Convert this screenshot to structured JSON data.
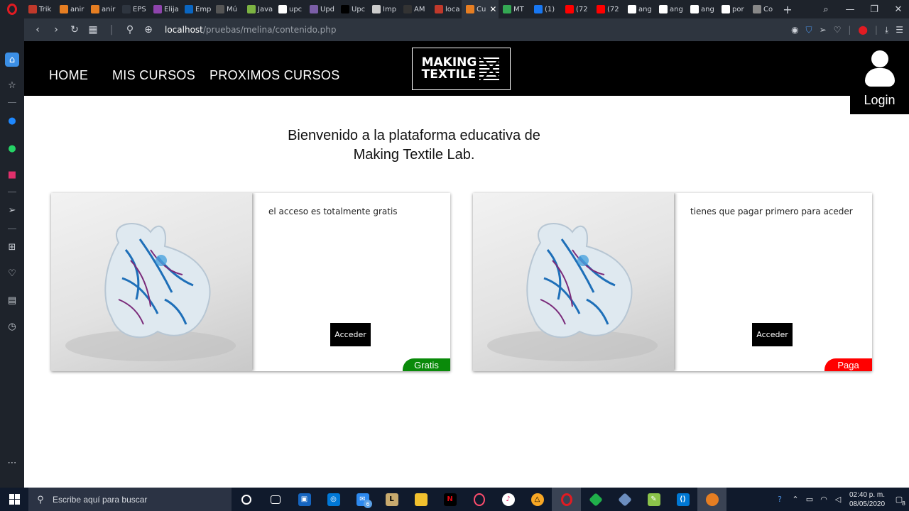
{
  "browser": {
    "tabs": [
      {
        "label": "Trik",
        "icon": "bookmark-icon",
        "color": "#c0392b"
      },
      {
        "label": "anir",
        "icon": "af-icon",
        "color": "#e67e22"
      },
      {
        "label": "anir",
        "icon": "af-icon",
        "color": "#e67e22"
      },
      {
        "label": "EPS",
        "icon": "",
        "color": "#2e353f"
      },
      {
        "label": "Elija",
        "icon": "circle-icon",
        "color": "#8e44ad"
      },
      {
        "label": "Emp",
        "icon": "linkedin-icon",
        "color": "#0a66c2"
      },
      {
        "label": "Mú",
        "icon": "m-icon",
        "color": "#555555"
      },
      {
        "label": "Java",
        "icon": "android-icon",
        "color": "#7cb342"
      },
      {
        "label": "upc",
        "icon": "google-icon",
        "color": "#ffffff"
      },
      {
        "label": "Upd",
        "icon": "flag-icon",
        "color": "#7b5ea7"
      },
      {
        "label": "Upc",
        "icon": "medium-icon",
        "color": "#000000"
      },
      {
        "label": "Imp",
        "icon": "page-icon",
        "color": "#cccccc"
      },
      {
        "label": "AM",
        "icon": "am-icon",
        "color": "#333333"
      },
      {
        "label": "loca",
        "icon": "local-icon",
        "color": "#c0392b"
      },
      {
        "label": "Cu",
        "icon": "cu-icon",
        "color": "#e67e22",
        "active": true
      },
      {
        "label": "MT",
        "icon": "drive-icon",
        "color": "#34a853"
      },
      {
        "label": "(1)",
        "icon": "facebook-icon",
        "color": "#1877f2"
      },
      {
        "label": "(72",
        "icon": "youtube-icon",
        "color": "#ff0000"
      },
      {
        "label": "(72",
        "icon": "youtube-icon",
        "color": "#ff0000"
      },
      {
        "label": "ang",
        "icon": "google-icon",
        "color": "#ffffff"
      },
      {
        "label": "ang",
        "icon": "google-icon",
        "color": "#ffffff"
      },
      {
        "label": "ang",
        "icon": "google-icon",
        "color": "#ffffff"
      },
      {
        "label": "por",
        "icon": "google-icon",
        "color": "#ffffff"
      },
      {
        "label": "Co",
        "icon": "gear-icon",
        "color": "#888888"
      }
    ],
    "url_host": "localhost",
    "url_path": "/pruebas/melina/contenido.php"
  },
  "site": {
    "nav": [
      "HOME",
      "MIS CURSOS",
      "PROXIMOS CURSOS"
    ],
    "logo_line1": "MAKING",
    "logo_line2": "TEXTILE",
    "login_label": "Login",
    "welcome_line1": "Bienvenido a la plataforma educativa de",
    "welcome_line2": "Making Textile Lab.",
    "cards": [
      {
        "text": "el acceso es totalmente gratis",
        "button": "Acceder",
        "badge": "Gratis",
        "badge_color": "#0a8a0a"
      },
      {
        "text": "tienes que pagar primero para aceder",
        "button": "Acceder",
        "badge": "Paga",
        "badge_color": "#ff0000"
      }
    ]
  },
  "taskbar": {
    "search_placeholder": "Escribe aquí para buscar",
    "mail_badge": "6",
    "time": "02:40 p. m.",
    "date": "08/05/2020",
    "notification_count": "8"
  }
}
